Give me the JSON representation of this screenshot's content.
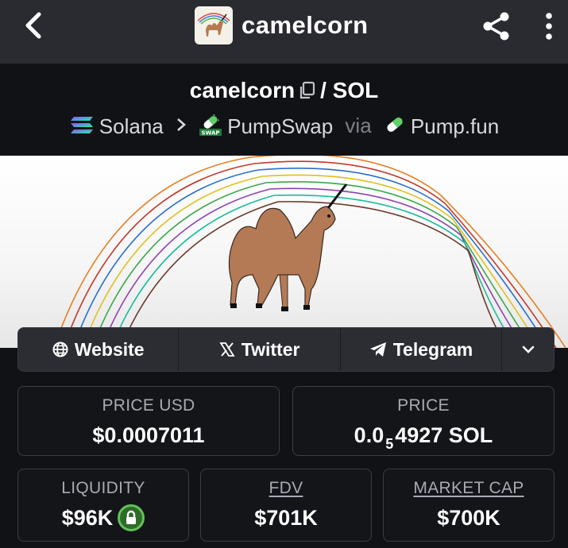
{
  "appbar": {
    "title": "camelcorn",
    "icons": [
      "back-arrow-icon",
      "camelcorn-logo",
      "share-icon",
      "more-vertical-icon"
    ]
  },
  "pair": {
    "token": "canelcorn",
    "quote": "/ SOL",
    "chain": "Solana",
    "dex": "PumpSwap",
    "via": "via",
    "launchpad": "Pump.fun"
  },
  "links": {
    "website": "Website",
    "twitter": "Twitter",
    "telegram": "Telegram"
  },
  "stats": {
    "price_usd_label": "PRICE USD",
    "price_usd": "$0.0007011",
    "price_label": "PRICE",
    "price_prefix": "0.0",
    "price_sub": "5",
    "price_suffix": "4927 SOL",
    "liquidity_label": "LIQUIDITY",
    "liquidity": "$96K",
    "fdv_label": "FDV",
    "fdv": "$701K",
    "mcap_label": "MARKET CAP",
    "mcap": "$700K"
  },
  "colors": {
    "appbar_bg": "#2a2b31",
    "page_bg": "#111216",
    "card_border": "#3b3d44",
    "label_gray": "#a7aab2",
    "lock_green": "#62c25a"
  }
}
